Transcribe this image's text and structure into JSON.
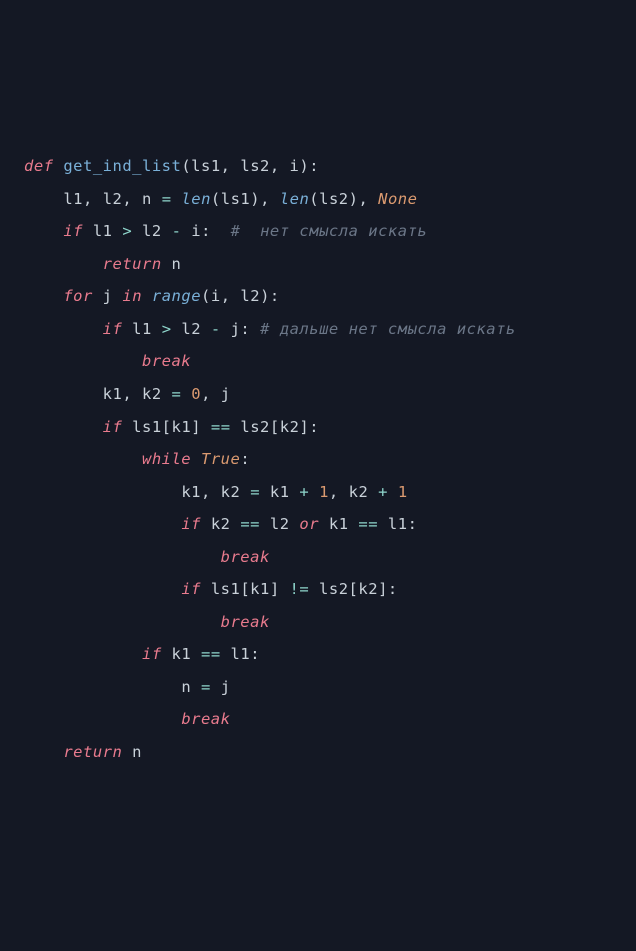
{
  "code": {
    "def": "def",
    "fn_name": "get_ind_list",
    "lp1": "(",
    "p_ls1": "ls1",
    "c1": ",",
    "p_ls2": "ls2",
    "c2": ",",
    "p_i": "i",
    "rp1": "):",
    "l1": "l1",
    "c3": ",",
    "l2": "l2",
    "c4": ",",
    "n": "n",
    "eq1": "=",
    "len1": "len",
    "lp2": "(",
    "arg_ls1": "ls1",
    "rp2": "),",
    "len2": "len",
    "lp3": "(",
    "arg_ls2": "ls2",
    "rp3": "),",
    "none": "None",
    "if1": "if",
    "l1_a": "l1",
    "gt1": ">",
    "l2_a": "l2",
    "minus1": "-",
    "i_a": "i",
    "col1": ":",
    "cmt1": "#  нет смысла искать",
    "ret1": "return",
    "n_a": "n",
    "for": "for",
    "j": "j",
    "in": "in",
    "range": "range",
    "lp4": "(",
    "i_b": "i",
    "c5": ",",
    "l2_b": "l2",
    "rp4": "):",
    "if2": "if",
    "l1_b": "l1",
    "gt2": ">",
    "l2_c": "l2",
    "minus2": "-",
    "j_a": "j",
    "col2": ":",
    "cmt2": "# дальше нет смысла искать",
    "brk1": "break",
    "k1": "k1",
    "c6": ",",
    "k2": "k2",
    "eq2": "=",
    "zero": "0",
    "c7": ",",
    "j_b": "j",
    "if3": "if",
    "ls1_a": "ls1",
    "lb1": "[",
    "k1_a": "k1",
    "rb1": "]",
    "eqeq1": "==",
    "ls2_a": "ls2",
    "lb2": "[",
    "k2_a": "k2",
    "rb2": "]:",
    "while": "while",
    "true": "True",
    "col3": ":",
    "k1_b": "k1",
    "c8": ",",
    "k2_b": "k2",
    "eq3": "=",
    "k1_c": "k1",
    "plus1": "+",
    "one1": "1",
    "c9": ",",
    "k2_c": "k2",
    "plus2": "+",
    "one2": "1",
    "if4": "if",
    "k2_d": "k2",
    "eqeq2": "==",
    "l2_d": "l2",
    "or": "or",
    "k1_d": "k1",
    "eqeq3": "==",
    "l1_c": "l1",
    "col4": ":",
    "brk2": "break",
    "if5": "if",
    "ls1_b": "ls1",
    "lb3": "[",
    "k1_e": "k1",
    "rb3": "]",
    "neq": "!=",
    "ls2_b": "ls2",
    "lb4": "[",
    "k2_e": "k2",
    "rb4": "]:",
    "brk3": "break",
    "if6": "if",
    "k1_f": "k1",
    "eqeq4": "==",
    "l1_d": "l1",
    "col5": ":",
    "n_b": "n",
    "eq4": "=",
    "j_c": "j",
    "brk4": "break",
    "ret2": "return",
    "n_c": "n"
  }
}
